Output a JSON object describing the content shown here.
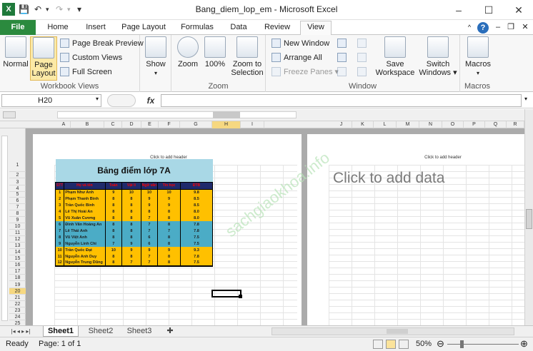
{
  "window": {
    "title": "Bang_diem_lop_em  -  Microsoft Excel",
    "minimize": "–",
    "maximize": "☐",
    "close": "✕"
  },
  "qat": {
    "save": "💾",
    "undo": "↶",
    "redo": "↷",
    "customize": "▾"
  },
  "tabs": [
    "File",
    "Home",
    "Insert",
    "Page Layout",
    "Formulas",
    "Data",
    "Review",
    "View"
  ],
  "active_tab": "View",
  "ribbon": {
    "workbook_views": {
      "label": "Workbook Views",
      "normal": "Normal",
      "page_layout": "Page Layout",
      "page_break_preview": "Page Break Preview",
      "custom_views": "Custom Views",
      "full_screen": "Full Screen"
    },
    "show": {
      "label": "Show"
    },
    "zoom": {
      "label": "Zoom",
      "zoom": "Zoom",
      "hundred": "100%",
      "zoom_to_selection": "Zoom to Selection"
    },
    "window": {
      "label": "Window",
      "new_window": "New Window",
      "arrange_all": "Arrange All",
      "freeze_panes": "Freeze Panes",
      "save_workspace": "Save Workspace",
      "switch_windows": "Switch Windows"
    },
    "macros": {
      "label": "Macros",
      "macros": "Macros"
    }
  },
  "formula_bar": {
    "name_box": "H20",
    "fx": "fx",
    "value": ""
  },
  "columns_left": [
    "A",
    "B",
    "C",
    "D",
    "E",
    "F",
    "G",
    "H",
    "I"
  ],
  "columns_right": [
    "J",
    "K",
    "L",
    "M",
    "N",
    "O",
    "P",
    "Q",
    "R"
  ],
  "rows": [
    "1",
    "2",
    "3",
    "4",
    "5",
    "6",
    "7",
    "8",
    "9",
    "10",
    "11",
    "12",
    "13",
    "14",
    "15",
    "16",
    "17",
    "18",
    "19",
    "20",
    "21",
    "22",
    "23",
    "24",
    "25"
  ],
  "page": {
    "header_hint": "Click to add header",
    "add_data": "Click to add data"
  },
  "watermark": "sachgiaokhoa.info",
  "table": {
    "title": "Bảng điểm lớp 7A",
    "headers": [
      "STT",
      "Họ và tên",
      "Toán",
      "Vật lí",
      "Ngữ văn",
      "Tin học",
      "ĐTB"
    ],
    "rows": [
      [
        "1",
        "Phạm Như Anh",
        "9",
        "10",
        "10",
        "10",
        "9.8"
      ],
      [
        "2",
        "Phạm Thanh Bình",
        "8",
        "8",
        "9",
        "9",
        "8.5"
      ],
      [
        "3",
        "Trần Quốc Bình",
        "8",
        "8",
        "9",
        "9",
        "8.5"
      ],
      [
        "4",
        "Lê Thị Hoài An",
        "8",
        "8",
        "8",
        "8",
        "8.0"
      ],
      [
        "5",
        "Vũ Xuân Cương",
        "8",
        "8",
        "7",
        "8",
        "8.0"
      ],
      [
        "6",
        "Đinh Văn Hoàng An",
        "8",
        "8",
        "7",
        "8",
        "7.8"
      ],
      [
        "7",
        "Lê Thái Anh",
        "8",
        "8",
        "7",
        "7",
        "7.8"
      ],
      [
        "8",
        "Vũ Việt Anh",
        "8",
        "8",
        "6",
        "8",
        "7.5"
      ],
      [
        "9",
        "Nguyễn Linh Chi",
        "7",
        "9",
        "6",
        "8",
        "7.5"
      ],
      [
        "10",
        "Trần Quốc Đạt",
        "10",
        "9",
        "9",
        "9",
        "9.3"
      ],
      [
        "11",
        "Nguyễn Anh Duy",
        "8",
        "8",
        "7",
        "8",
        "7.8"
      ],
      [
        "12",
        "Nguyễn Trung Dũng",
        "8",
        "7",
        "7",
        "8",
        "7.5"
      ]
    ],
    "row_colors": [
      "yellow",
      "yellow",
      "yellow",
      "yellow",
      "yellow",
      "blue",
      "blue",
      "blue",
      "blue",
      "yellow",
      "yellow",
      "yellow"
    ]
  },
  "sheets": [
    "Sheet1",
    "Sheet2",
    "Sheet3"
  ],
  "active_sheet": "Sheet1",
  "status": {
    "ready": "Ready",
    "page": "Page: 1 of 1",
    "zoom": "50%"
  },
  "colors": {
    "title_fill": "#a9d8e6",
    "yellow": "#ffc000",
    "blue": "#4bacc6",
    "header_fill": "#1f2a6b",
    "header_text": "#ff0000",
    "file_tab": "#2b8a3e"
  }
}
